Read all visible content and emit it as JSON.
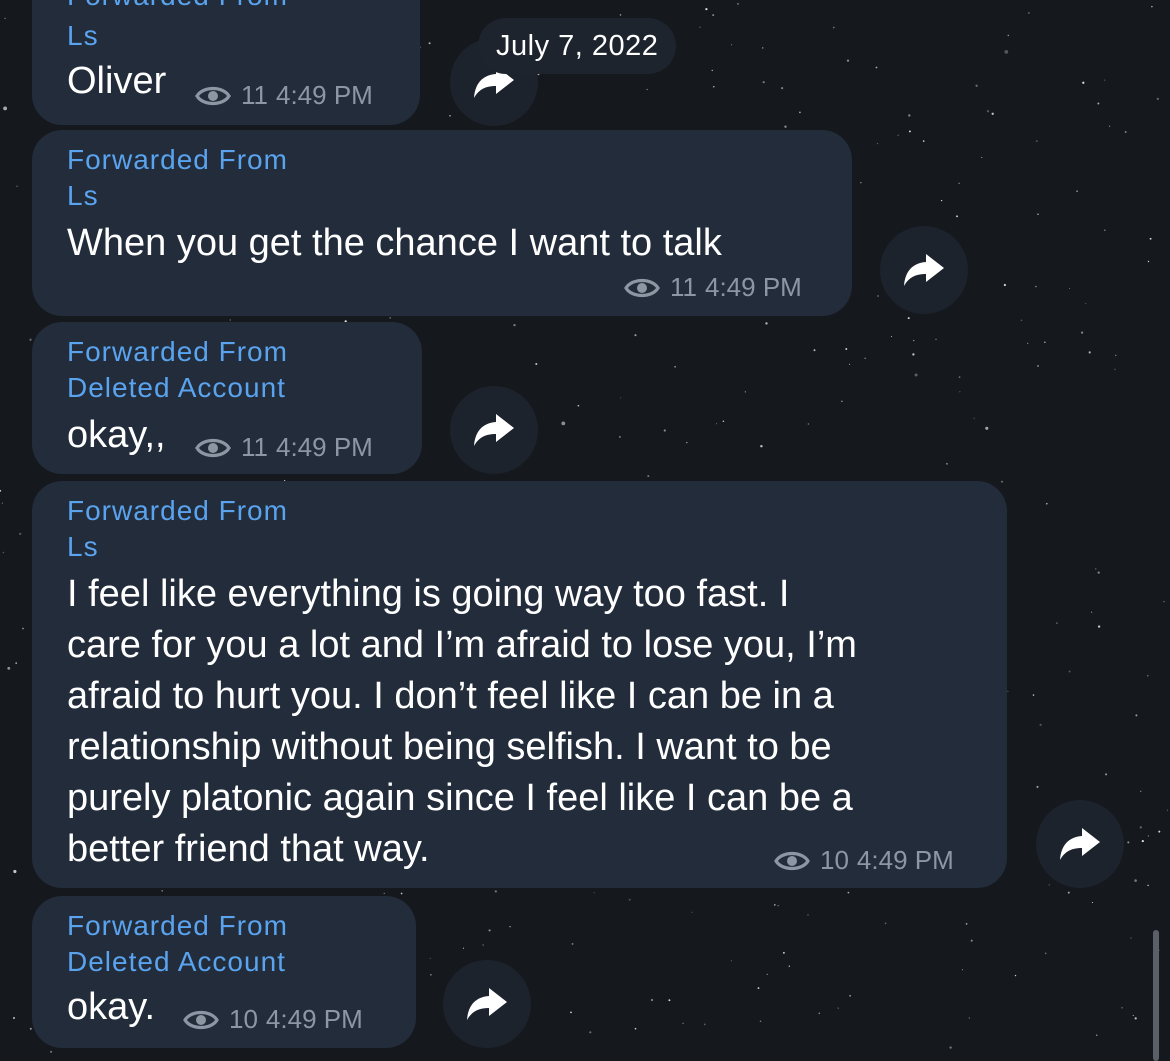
{
  "date_label": "July 7, 2022",
  "forward_label": "Forwarded From",
  "messages": [
    {
      "sender": "Ls",
      "text": "Oliver",
      "views": "11",
      "time": "4:49 PM"
    },
    {
      "sender": "Ls",
      "text": "When you get the chance I want to talk",
      "views": "11",
      "time": "4:49 PM"
    },
    {
      "sender": "Deleted Account",
      "text": "okay,,",
      "views": "11",
      "time": "4:49 PM"
    },
    {
      "sender": "Ls",
      "text_lines": [
        "I feel like everything is going way too fast. I",
        "care for you a lot and I’m afraid to lose you, I’m",
        "afraid to hurt you. I don’t feel like I can be in a",
        "relationship without being selfish. I want to be",
        "purely platonic again since I feel like I can be a",
        "better friend that way."
      ],
      "views": "10",
      "time": "4:49 PM"
    },
    {
      "sender": "Deleted Account",
      "text": "okay.",
      "views": "10",
      "time": "4:49 PM"
    }
  ],
  "icons": {
    "view": "eye-icon",
    "share": "share-arrow-icon"
  },
  "colors": {
    "bubble": "#222c3a",
    "accent": "#5aa3ee",
    "meta": "#8d97a4",
    "text": "#ffffff"
  }
}
